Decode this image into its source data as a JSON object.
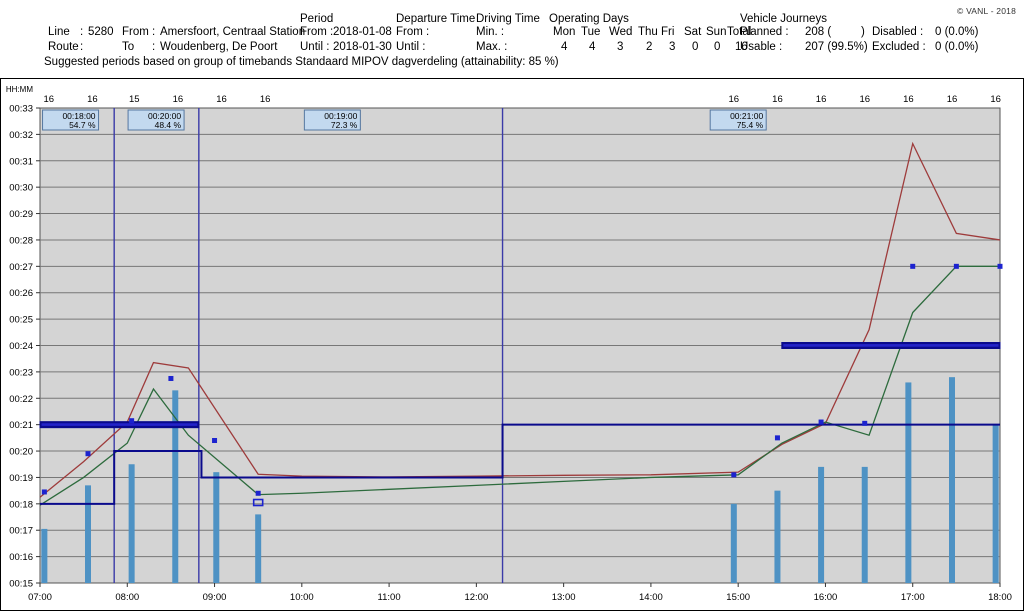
{
  "header": {
    "copyright": "© VANL - 2018",
    "line": {
      "label": "Line",
      "sep": ":",
      "value": "5280"
    },
    "route": {
      "label": "Route",
      "sep": ":",
      "value": ""
    },
    "from": {
      "label": "From",
      "sep": ":",
      "value": "Amersfoort, Centraal Station"
    },
    "to": {
      "label": "To",
      "sep": ":",
      "value": "Woudenberg, De Poort"
    },
    "period": {
      "title": "Period",
      "from_label": "From :",
      "from_value": "2018-01-08",
      "until_label": "Until :",
      "until_value": "2018-01-30"
    },
    "departure_time": {
      "title": "Departure Time",
      "from_label": "From :",
      "from_value": "",
      "until_label": "Until :",
      "until_value": ""
    },
    "driving_time": {
      "title": "Driving Time",
      "min_label": "Min. :",
      "min_value": "",
      "max_label": "Max. :",
      "max_value": ""
    },
    "operating_days": {
      "title": "Operating Days",
      "days": [
        "Mon",
        "Tue",
        "Wed",
        "Thu",
        "Fri",
        "Sat",
        "Sun",
        "Total"
      ],
      "counts": [
        "4",
        "4",
        "3",
        "2",
        "3",
        "0",
        "0",
        "16"
      ]
    },
    "vehicle_journeys": {
      "title": "Vehicle Journeys",
      "planned_label": "Planned :",
      "planned_value": "208 (",
      "planned_paren": ")",
      "usable_label": "Usable   :",
      "usable_value": "207 (99.5%)",
      "disabled_label": "Disabled  :",
      "disabled_value": "0 (0.0%)",
      "excluded_label": "Excluded :",
      "excluded_value": "0 (0.0%)"
    },
    "suggested": "Suggested periods based on group of timebands Standaard MIPOV dagverdeling (attainability: 85 %)"
  },
  "chart_data": {
    "type": "line",
    "title": "",
    "xlabel": "",
    "ylabel": "HH:MM",
    "y_axis_caption": "HH:MM",
    "ylim": [
      15,
      33
    ],
    "ytick_labels": [
      "00:33",
      "00:32",
      "00:31",
      "00:30",
      "00:29",
      "00:28",
      "00:27",
      "00:26",
      "00:25",
      "00:24",
      "00:23",
      "00:22",
      "00:21",
      "00:20",
      "00:19",
      "00:18",
      "00:17",
      "00:16",
      "00:15"
    ],
    "ytick_values": [
      33,
      32,
      31,
      30,
      29,
      28,
      27,
      26,
      25,
      24,
      23,
      22,
      21,
      20,
      19,
      18,
      17,
      16,
      15
    ],
    "xlim": [
      "07:00",
      "18:00"
    ],
    "xtick_labels": [
      "07:00",
      "08:00",
      "09:00",
      "10:00",
      "11:00",
      "12:00",
      "13:00",
      "14:00",
      "15:00",
      "16:00",
      "17:00",
      "18:00"
    ],
    "xtick_values": [
      7,
      8,
      9,
      10,
      11,
      12,
      13,
      14,
      15,
      16,
      17,
      18
    ],
    "grid": true,
    "legend_position": "none",
    "top_counts": [
      {
        "x": 7.1,
        "label": "16"
      },
      {
        "x": 7.6,
        "label": "16"
      },
      {
        "x": 8.08,
        "label": "15"
      },
      {
        "x": 8.58,
        "label": "16"
      },
      {
        "x": 9.08,
        "label": "16"
      },
      {
        "x": 9.58,
        "label": "16"
      },
      {
        "x": 14.95,
        "label": "16"
      },
      {
        "x": 15.45,
        "label": "16"
      },
      {
        "x": 15.95,
        "label": "16"
      },
      {
        "x": 16.45,
        "label": "16"
      },
      {
        "x": 16.95,
        "label": "16"
      },
      {
        "x": 17.45,
        "label": "16"
      },
      {
        "x": 17.95,
        "label": "16"
      }
    ],
    "period_boxes": [
      {
        "x": 7.35,
        "time": "00:18:00",
        "pct": "54.7 %"
      },
      {
        "x": 8.33,
        "time": "00:20:00",
        "pct": "48.4 %"
      },
      {
        "x": 10.35,
        "time": "00:19:00",
        "pct": "72.3 %"
      },
      {
        "x": 15.0,
        "time": "00:21:00",
        "pct": "75.4 %"
      }
    ],
    "period_dividers": [
      7.85,
      8.82,
      12.3
    ],
    "series": [
      {
        "name": "max-driving-time",
        "color": "#9e3b3b",
        "points": [
          [
            7.0,
            18.25
          ],
          [
            7.5,
            19.6
          ],
          [
            8.0,
            21.1
          ],
          [
            8.3,
            23.35
          ],
          [
            8.7,
            23.15
          ],
          [
            9.5,
            19.12
          ],
          [
            10.0,
            19.05
          ],
          [
            11.0,
            19.02
          ],
          [
            12.0,
            19.05
          ],
          [
            13.0,
            19.08
          ],
          [
            14.0,
            19.1
          ],
          [
            15.0,
            19.2
          ],
          [
            15.5,
            20.25
          ],
          [
            16.0,
            21.05
          ],
          [
            16.5,
            24.6
          ],
          [
            17.0,
            31.65
          ],
          [
            17.5,
            28.25
          ],
          [
            18.0,
            28.0
          ]
        ]
      },
      {
        "name": "min-driving-time",
        "color": "#2d6b3d",
        "points": [
          [
            7.0,
            17.95
          ],
          [
            7.5,
            19.0
          ],
          [
            8.0,
            20.3
          ],
          [
            8.3,
            22.35
          ],
          [
            8.7,
            20.6
          ],
          [
            9.5,
            18.35
          ],
          [
            10.0,
            18.4
          ],
          [
            11.0,
            18.55
          ],
          [
            12.0,
            18.7
          ],
          [
            13.0,
            18.85
          ],
          [
            14.0,
            19.0
          ],
          [
            15.0,
            19.1
          ],
          [
            15.5,
            20.3
          ],
          [
            16.0,
            21.1
          ],
          [
            16.5,
            20.6
          ],
          [
            17.0,
            25.25
          ],
          [
            17.5,
            27.0
          ],
          [
            18.0,
            27.0
          ]
        ]
      }
    ],
    "markers": {
      "name": "median-driving-time",
      "color": "#1c23cf",
      "points": [
        [
          7.05,
          18.45
        ],
        [
          7.55,
          19.9
        ],
        [
          8.05,
          21.15
        ],
        [
          8.5,
          22.75
        ],
        [
          9.0,
          20.4
        ],
        [
          9.5,
          18.4
        ],
        [
          14.95,
          19.1
        ],
        [
          15.45,
          20.5
        ],
        [
          15.95,
          21.1
        ],
        [
          16.45,
          21.05
        ],
        [
          17.0,
          27.0
        ],
        [
          17.5,
          27.0
        ],
        [
          18.0,
          27.0
        ]
      ],
      "hollow_points": [
        [
          9.5,
          18.05
        ]
      ]
    },
    "bars": {
      "name": "journey-count-bars",
      "color": "#4e92c4",
      "baseline": 15,
      "values": [
        {
          "x": 7.05,
          "top": 17.05
        },
        {
          "x": 7.55,
          "top": 18.7
        },
        {
          "x": 8.05,
          "top": 19.5
        },
        {
          "x": 8.55,
          "top": 22.3
        },
        {
          "x": 9.02,
          "top": 19.2
        },
        {
          "x": 9.5,
          "top": 17.6
        },
        {
          "x": 14.95,
          "top": 18.0
        },
        {
          "x": 15.45,
          "top": 18.5
        },
        {
          "x": 15.95,
          "top": 19.4
        },
        {
          "x": 16.45,
          "top": 19.4
        },
        {
          "x": 16.95,
          "top": 22.6
        },
        {
          "x": 17.45,
          "top": 22.8
        },
        {
          "x": 17.95,
          "top": 21.0
        }
      ]
    },
    "step_line": {
      "name": "suggested-driving-time-step",
      "color": "#0a0a8c",
      "points": [
        [
          7.0,
          18
        ],
        [
          7.85,
          18
        ],
        [
          7.85,
          20
        ],
        [
          8.85,
          20
        ],
        [
          8.85,
          19
        ],
        [
          12.3,
          19
        ],
        [
          12.3,
          21
        ],
        [
          18.0,
          21
        ]
      ]
    },
    "thick_segments": {
      "name": "selected-period-bars",
      "color": "#0a0a8c",
      "segments": [
        {
          "x0": 7.0,
          "x1": 8.82,
          "y": 21
        },
        {
          "x0": 15.5,
          "x1": 18.0,
          "y": 24
        }
      ]
    }
  }
}
